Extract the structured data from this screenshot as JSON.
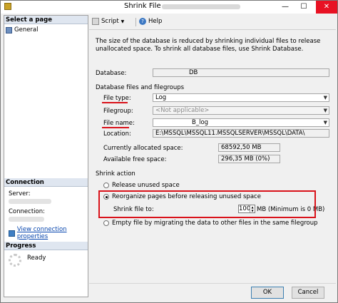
{
  "window": {
    "title": "Shrink File -"
  },
  "left": {
    "select_page_header": "Select a page",
    "nav_general": "General",
    "connection_header": "Connection",
    "server_label": "Server:",
    "connection_label": "Connection:",
    "view_connection_link": "View connection properties",
    "progress_header": "Progress",
    "progress_status": "Ready"
  },
  "toolbar": {
    "script_label": "Script",
    "help_label": "Help"
  },
  "main": {
    "description": "The size of the database is reduced by shrinking individual files to release unallocated space. To shrink all database files, use Shrink Database.",
    "database_label": "Database:",
    "database_value": "DB",
    "files_section": "Database files and filegroups",
    "file_type_label": "File type:",
    "file_type_value": "Log",
    "filegroup_label": "Filegroup:",
    "filegroup_value": "<Not applicable>",
    "file_name_label": "File name:",
    "file_name_value": "B_log",
    "location_label": "Location:",
    "location_value": "E:\\MSSQL\\MSSQL11.MSSQLSERVER\\MSSQL\\DATA\\",
    "allocated_label": "Currently allocated space:",
    "allocated_value": "68592,50 MB",
    "free_label": "Available free space:",
    "free_value": "296,35 MB (0%)",
    "shrink_action": "Shrink action",
    "opt_release": "Release unused space",
    "opt_reorganize": "Reorganize pages before releasing unused space",
    "shrink_to_label": "Shrink file to:",
    "shrink_to_value": "100",
    "shrink_unit": "MB (Minimum is 0 MB)",
    "opt_empty": "Empty file by migrating the data to other files in the same filegroup"
  },
  "buttons": {
    "ok": "OK",
    "cancel": "Cancel"
  }
}
